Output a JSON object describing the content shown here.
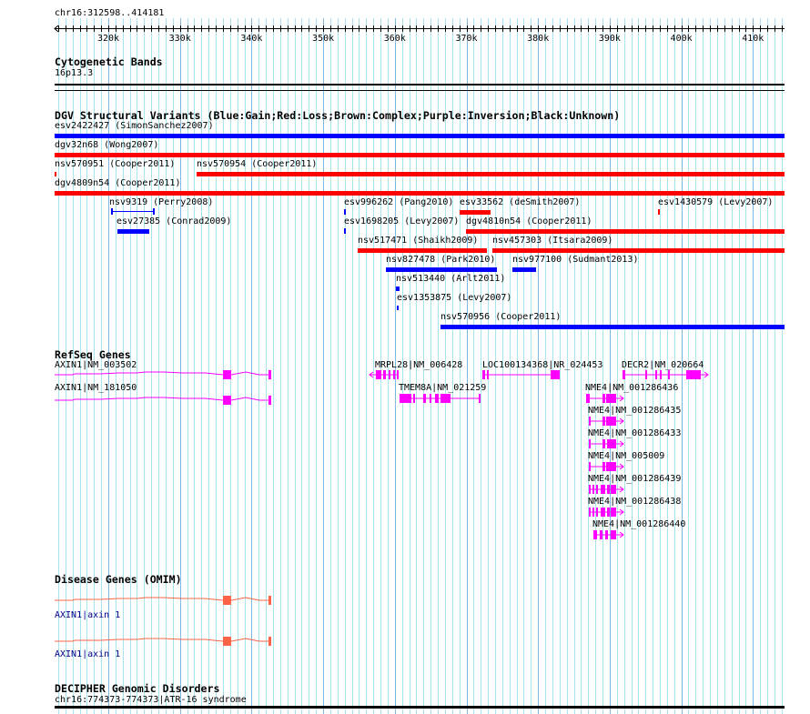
{
  "ruler": {
    "region": "chr16:312598..414181",
    "ticks": [
      "320k",
      "330k",
      "340k",
      "350k",
      "360k",
      "370k",
      "380k",
      "390k",
      "400k",
      "410k"
    ]
  },
  "tracks": {
    "cytoband": {
      "title": "Cytogenetic Bands",
      "band": "16p13.3"
    },
    "dgv": {
      "title": "DGV Structural Variants (Blue:Gain;Red:Loss;Brown:Complex;Purple:Inversion;Black:Unknown)",
      "colors": {
        "gain": "#0000ff",
        "loss": "#ff0000"
      },
      "features": [
        {
          "label": "esv2422427 (SimonSanchez2007)",
          "type": "gain"
        },
        {
          "label": "dgv32n68 (Wong2007)",
          "type": "loss"
        },
        {
          "label": "nsv570951 (Cooper2011)",
          "type": "loss"
        },
        {
          "label": "nsv570954 (Cooper2011)",
          "type": "loss"
        },
        {
          "label": "dgv4809n54 (Cooper2011)",
          "type": "loss"
        },
        {
          "label": "nsv9319 (Perry2008)",
          "type": "gain"
        },
        {
          "label": "esv27385 (Conrad2009)",
          "type": "gain"
        },
        {
          "label": "esv996262 (Pang2010)",
          "type": "gain"
        },
        {
          "label": "esv33562 (deSmith2007)",
          "type": "loss"
        },
        {
          "label": "esv1430579 (Levy2007)",
          "type": "loss"
        },
        {
          "label": "esv1698205 (Levy2007)",
          "type": "gain"
        },
        {
          "label": "dgv4810n54 (Cooper2011)",
          "type": "loss"
        },
        {
          "label": "nsv517471 (Shaikh2009)",
          "type": "loss"
        },
        {
          "label": "nsv457303 (Itsara2009)",
          "type": "loss"
        },
        {
          "label": "nsv827478 (Park2010)",
          "type": "gain"
        },
        {
          "label": "nsv977100 (Sudmant2013)",
          "type": "gain"
        },
        {
          "label": "nsv513440 (Arlt2011)",
          "type": "gain"
        },
        {
          "label": "esv1353875 (Levy2007)",
          "type": "gain"
        },
        {
          "label": "nsv570956 (Cooper2011)",
          "type": "gain"
        }
      ]
    },
    "refseq": {
      "title": "RefSeq Genes",
      "color": "#ff00ff",
      "genes": [
        "AXIN1|NM_003502",
        "AXIN1|NM_181050",
        "MRPL28|NM_006428",
        "TMEM8A|NM_021259",
        "LOC100134368|NR_024453",
        "DECR2|NM_020664",
        "NME4|NM_001286436",
        "NME4|NM_001286435",
        "NME4|NM_001286433",
        "NME4|NM_005009",
        "NME4|NM_001286439",
        "NME4|NM_001286438",
        "NME4|NM_001286440"
      ]
    },
    "omim": {
      "title": "Disease Genes (OMIM)",
      "color": "#ff6347",
      "genes": [
        "AXIN1|axin 1",
        "AXIN1|axin 1"
      ]
    },
    "decipher": {
      "title": "DECIPHER Genomic Disorders",
      "feature": "chr16:774373-774373|ATR-16 syndrome"
    }
  }
}
